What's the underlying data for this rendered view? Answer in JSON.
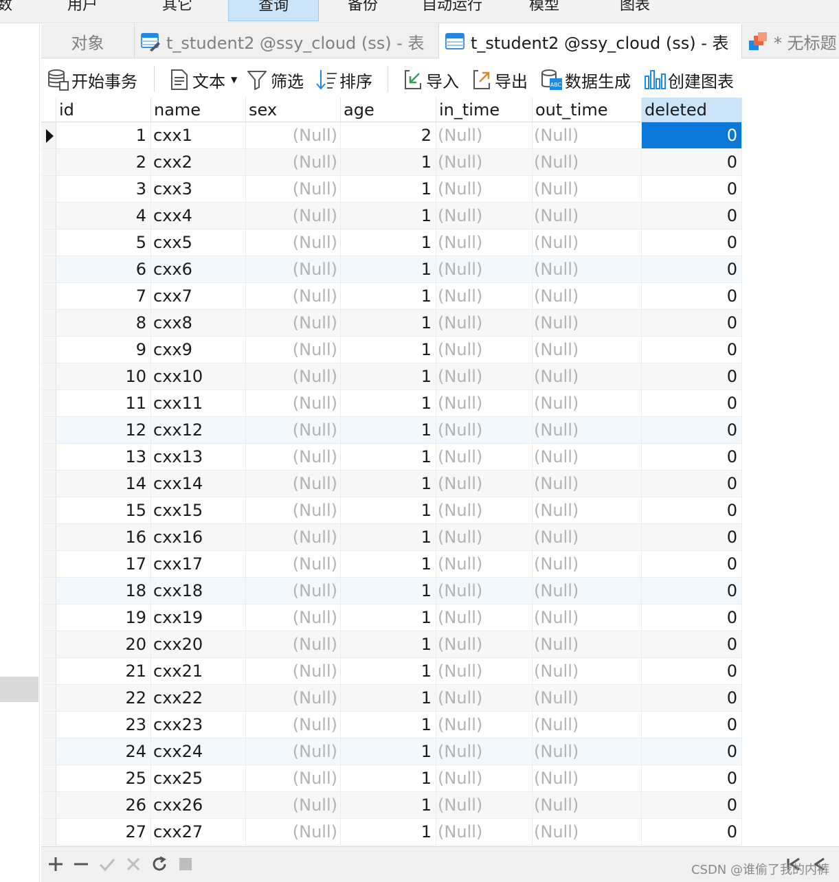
{
  "menu": {
    "items": [
      {
        "label": "数"
      },
      {
        "label": "用户"
      },
      {
        "label": "其它"
      },
      {
        "label": "查询",
        "active": true
      },
      {
        "label": "备份"
      },
      {
        "label": "自动运行"
      },
      {
        "label": "模型"
      },
      {
        "label": "图表"
      }
    ]
  },
  "tabs": [
    {
      "label": "对象",
      "icon": "none",
      "active": false
    },
    {
      "label": "t_student2 @ssy_cloud (ss) - 表",
      "icon": "table-edit-icon",
      "active": false
    },
    {
      "label": "t_student2 @ssy_cloud (ss) - 表",
      "icon": "table-icon",
      "active": true
    },
    {
      "label": "* 无标题",
      "icon": "chart-icon",
      "active": false
    }
  ],
  "toolbar": {
    "begin_transaction": "开始事务",
    "text": "文本",
    "filter": "筛选",
    "sort": "排序",
    "import": "导入",
    "export": "导出",
    "generate_data": "数据生成",
    "create_chart": "创建图表"
  },
  "grid": {
    "columns": [
      "id",
      "name",
      "sex",
      "age",
      "in_time",
      "out_time",
      "deleted"
    ],
    "selected_column": "deleted",
    "null_text": "(Null)",
    "rows": [
      {
        "id": "1",
        "name": "cxx1",
        "age": "2",
        "deleted": "0"
      },
      {
        "id": "2",
        "name": "cxx2",
        "age": "1",
        "deleted": "0"
      },
      {
        "id": "3",
        "name": "cxx3",
        "age": "1",
        "deleted": "0"
      },
      {
        "id": "4",
        "name": "cxx4",
        "age": "1",
        "deleted": "0"
      },
      {
        "id": "5",
        "name": "cxx5",
        "age": "1",
        "deleted": "0"
      },
      {
        "id": "6",
        "name": "cxx6",
        "age": "1",
        "deleted": "0"
      },
      {
        "id": "7",
        "name": "cxx7",
        "age": "1",
        "deleted": "0"
      },
      {
        "id": "8",
        "name": "cxx8",
        "age": "1",
        "deleted": "0"
      },
      {
        "id": "9",
        "name": "cxx9",
        "age": "1",
        "deleted": "0"
      },
      {
        "id": "10",
        "name": "cxx10",
        "age": "1",
        "deleted": "0"
      },
      {
        "id": "11",
        "name": "cxx11",
        "age": "1",
        "deleted": "0"
      },
      {
        "id": "12",
        "name": "cxx12",
        "age": "1",
        "deleted": "0"
      },
      {
        "id": "13",
        "name": "cxx13",
        "age": "1",
        "deleted": "0"
      },
      {
        "id": "14",
        "name": "cxx14",
        "age": "1",
        "deleted": "0"
      },
      {
        "id": "15",
        "name": "cxx15",
        "age": "1",
        "deleted": "0"
      },
      {
        "id": "16",
        "name": "cxx16",
        "age": "1",
        "deleted": "0"
      },
      {
        "id": "17",
        "name": "cxx17",
        "age": "1",
        "deleted": "0"
      },
      {
        "id": "18",
        "name": "cxx18",
        "age": "1",
        "deleted": "0"
      },
      {
        "id": "19",
        "name": "cxx19",
        "age": "1",
        "deleted": "0"
      },
      {
        "id": "20",
        "name": "cxx20",
        "age": "1",
        "deleted": "0"
      },
      {
        "id": "21",
        "name": "cxx21",
        "age": "1",
        "deleted": "0"
      },
      {
        "id": "22",
        "name": "cxx22",
        "age": "1",
        "deleted": "0"
      },
      {
        "id": "23",
        "name": "cxx23",
        "age": "1",
        "deleted": "0"
      },
      {
        "id": "24",
        "name": "cxx24",
        "age": "1",
        "deleted": "0"
      },
      {
        "id": "25",
        "name": "cxx25",
        "age": "1",
        "deleted": "0"
      },
      {
        "id": "26",
        "name": "cxx26",
        "age": "1",
        "deleted": "0"
      },
      {
        "id": "27",
        "name": "cxx27",
        "age": "1",
        "deleted": "0"
      }
    ]
  },
  "bottom": {
    "watermark": "CSDN @谁偷了我的内裤"
  },
  "colors": {
    "selection": "#0a78d7",
    "header_selected": "#cce4f7",
    "null_text": "#b3b3b3"
  }
}
